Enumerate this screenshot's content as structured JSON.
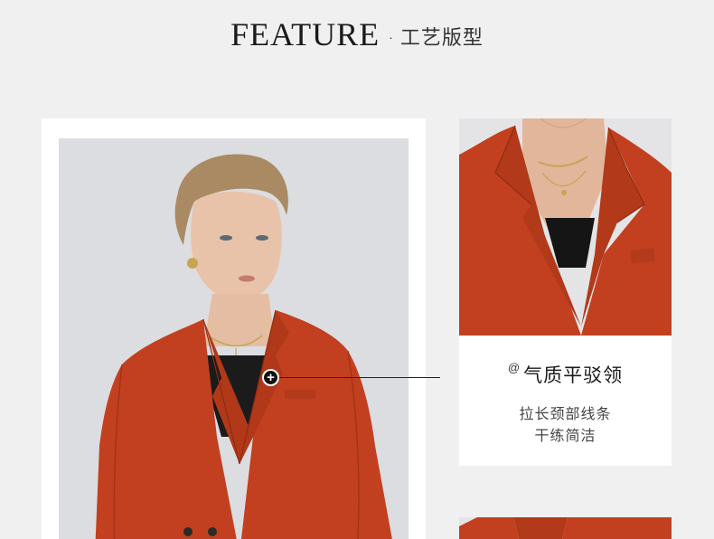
{
  "header": {
    "title": "FEATURE",
    "separator": "·",
    "subtitle": "工艺版型"
  },
  "hotspot": {
    "glyph": "+"
  },
  "feature": {
    "at_symbol": "@",
    "title": "气质平驳领",
    "lines": [
      "拉长颈部线条",
      "干练简洁"
    ]
  },
  "colors": {
    "page_bg": "#f0f0f0",
    "card_bg": "#ffffff",
    "blazer": "#c2401f",
    "text": "#1a1a1a"
  }
}
